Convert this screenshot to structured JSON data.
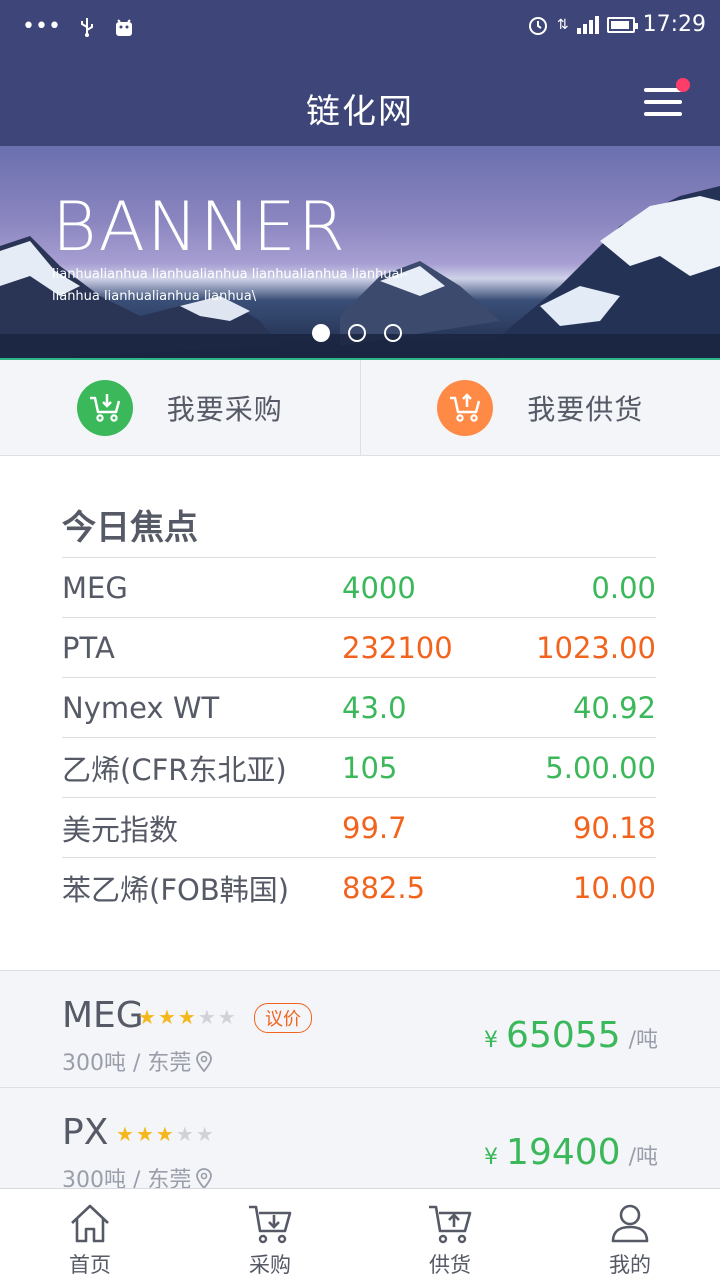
{
  "status_bar": {
    "time": "17:29"
  },
  "header": {
    "title": "链化网"
  },
  "banner": {
    "title": "BANNER",
    "subtitle": "lianhualianhua lianhualianhua lianhualianhua lianhual-lianhua lianhualianhua lianhua\\",
    "slide_count": 3,
    "active_slide": 1
  },
  "actions": [
    {
      "label": "我要采购",
      "icon": "cart-download-icon",
      "color": "#3bb85a"
    },
    {
      "label": "我要供货",
      "icon": "cart-upload-icon",
      "color": "#ff8a45"
    }
  ],
  "focus": {
    "title": "今日焦点",
    "rows": [
      {
        "name": "MEG",
        "value": "4000",
        "change": "0.00",
        "trend": "green"
      },
      {
        "name": "PTA",
        "value": "232100",
        "change": "1023.00",
        "trend": "orange"
      },
      {
        "name": "Nymex WT",
        "value": "43.0",
        "change": "40.92",
        "trend": "green"
      },
      {
        "name": "乙烯(CFR东北亚)",
        "value": "105",
        "change": "5.00.00",
        "trend": "green"
      },
      {
        "name": "美元指数",
        "value": "99.7",
        "change": "90.18",
        "trend": "orange"
      },
      {
        "name": "苯乙烯(FOB韩国)",
        "value": "882.5",
        "change": "10.00",
        "trend": "orange"
      }
    ]
  },
  "listings": [
    {
      "name": "MEG",
      "stars": 3,
      "tag": "议价",
      "qty": "300吨",
      "location": "/ 东莞",
      "currency": "¥",
      "price": "65055",
      "unit": "/吨"
    },
    {
      "name": "PX",
      "stars": 3,
      "tag": "",
      "qty": "300吨",
      "location": "/ 东莞",
      "currency": "¥",
      "price": "19400",
      "unit": "/吨"
    }
  ],
  "tabbar": [
    {
      "label": "首页",
      "icon": "home-icon"
    },
    {
      "label": "采购",
      "icon": "cart-download-icon"
    },
    {
      "label": "供货",
      "icon": "cart-upload-icon"
    },
    {
      "label": "我的",
      "icon": "user-icon"
    }
  ]
}
